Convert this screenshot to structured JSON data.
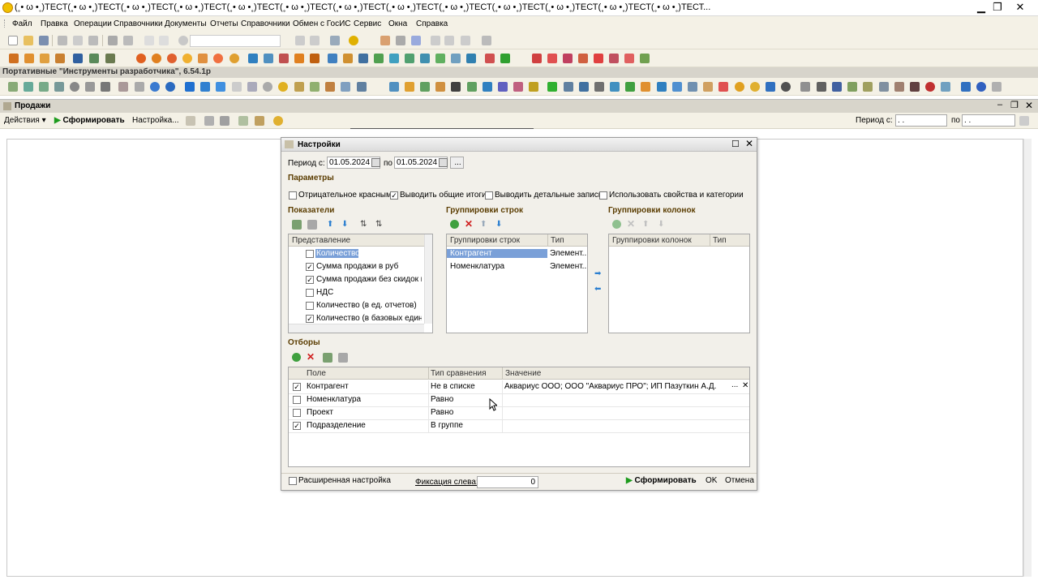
{
  "window": {
    "title": "(˳• ω •˳)ТЕСТ(˳• ω •˳)ТЕСТ(˳• ω •˳)ТЕСТ(˳• ω •˳)ТЕСТ(˳• ω •˳)ТЕСТ(˳• ω •˳)ТЕСТ(˳• ω •˳)ТЕСТ(˳• ω •˳)ТЕСТ(˳• ω •˳)ТЕСТ(˳• ω •˳)ТЕСТ(˳• ω •˳)ТЕСТ(˳• ω •˳)ТЕСТ(˳• ω •˳)ТЕСТ...",
    "minimize": "▁",
    "restore": "❐",
    "close": "✕"
  },
  "menu": [
    "Файл",
    "Правка",
    "Операции",
    "Справочники",
    "Документы",
    "Отчеты",
    "Справочники",
    "Обмен с ГосИС",
    "Сервис",
    "Окна",
    "Справка"
  ],
  "portable_bar": "Портативные \"Инструменты разработчика\", 6.54.1р",
  "report_window": {
    "title": "Продажи",
    "actions": "Действия",
    "generate": "Сформировать",
    "settings": "Настройка...",
    "period_from_label": "Период с:",
    "period_from_value": ". .",
    "period_to_label": "по",
    "period_to_value": ". ."
  },
  "dialog": {
    "title": "Настройки",
    "period_label": "Период с:",
    "period_from": "01.05.2024",
    "period_to_label": "по",
    "period_to": "01.05.2024",
    "period_more": "...",
    "params_title": "Параметры",
    "params": [
      {
        "label": "Отрицательное красным",
        "checked": false
      },
      {
        "label": "Выводить общие итоги",
        "checked": true
      },
      {
        "label": "Выводить детальные записи",
        "checked": false
      },
      {
        "label": "Использовать свойства и категории",
        "checked": false
      }
    ],
    "indicators": {
      "title": "Показатели",
      "header": "Представление",
      "items": [
        {
          "label": "Количество",
          "checked": false,
          "selected": true
        },
        {
          "label": "Сумма продажи в руб",
          "checked": true
        },
        {
          "label": "Сумма продажи без скидок в р",
          "checked": true
        },
        {
          "label": "НДС",
          "checked": false
        },
        {
          "label": "Количество (в ед. отчетов)",
          "checked": false
        },
        {
          "label": "Количество (в базовых единиц",
          "checked": true
        }
      ]
    },
    "row_groups": {
      "title": "Группировки строк",
      "headers": [
        "Группировки строк",
        "Тип"
      ],
      "rows": [
        {
          "name": "Контрагент",
          "type": "Элемент...",
          "selected": true
        },
        {
          "name": "Номенклатура",
          "type": "Элемент..."
        }
      ]
    },
    "col_groups": {
      "title": "Группировки колонок",
      "headers": [
        "Группировки колонок",
        "Тип"
      ]
    },
    "filters": {
      "title": "Отборы",
      "headers": [
        "Поле",
        "Тип сравнения",
        "Значение"
      ],
      "rows": [
        {
          "checked": true,
          "field": "Контрагент",
          "cmp": "Не в списке",
          "value": "Аквариус ООО; ООО \"Аквариус ПРО\"; ИП Пазуткин А.Д."
        },
        {
          "checked": false,
          "field": "Номенклатура",
          "cmp": "Равно",
          "value": ""
        },
        {
          "checked": false,
          "field": "Проект",
          "cmp": "Равно",
          "value": ""
        },
        {
          "checked": true,
          "field": "Подразделение",
          "cmp": "В группе",
          "value": ""
        }
      ]
    },
    "footer": {
      "extended": "Расширенная настройка",
      "fix_left": "Фиксация слева:",
      "fix_value": "0",
      "generate": "Сформировать",
      "ok": "OK",
      "cancel": "Отмена"
    }
  },
  "colors": {
    "selection": "#7aa0d8",
    "section_title": "#5a3c00",
    "accent_green": "#1d9b1d"
  }
}
